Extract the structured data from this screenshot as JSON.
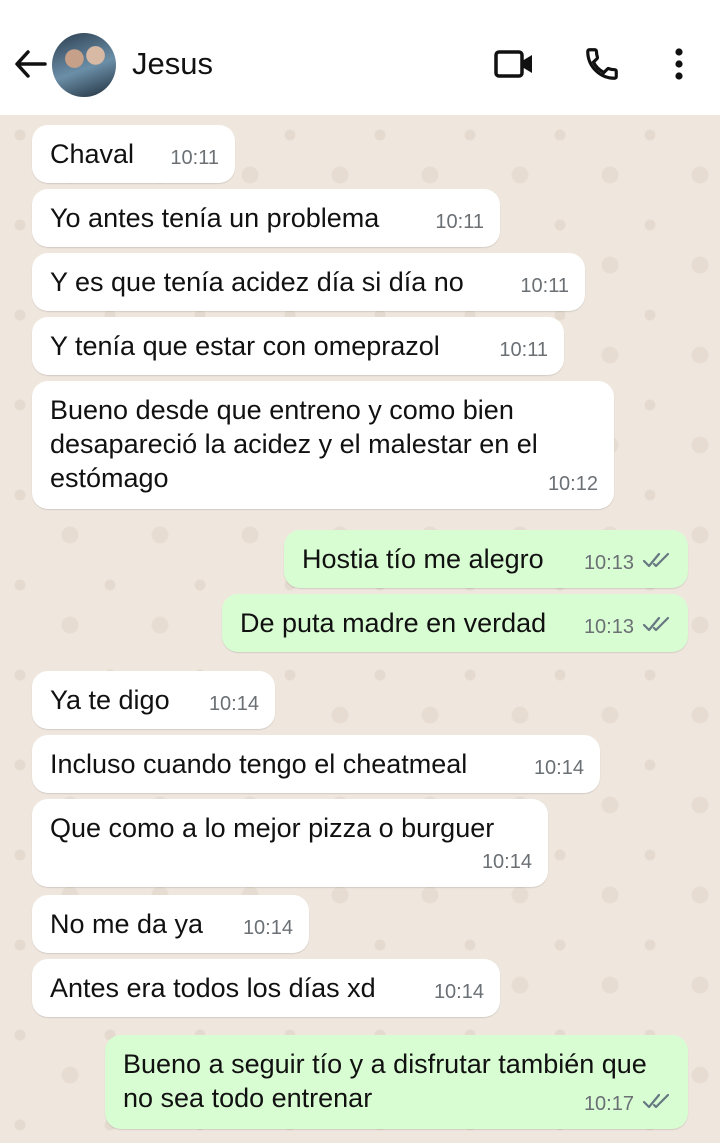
{
  "header": {
    "contact_name": "Jesus",
    "icons": [
      "back-arrow-icon",
      "video-call-icon",
      "phone-icon",
      "more-vertical-icon"
    ]
  },
  "colors": {
    "incoming_bubble": "#ffffff",
    "outgoing_bubble": "#d9fdd3",
    "chat_background": "#efe7de",
    "read_ticks": "#667781"
  },
  "messages": [
    {
      "dir": "in",
      "text": "Chaval",
      "time": "10:11"
    },
    {
      "dir": "in",
      "text": "Yo antes tenía un problema",
      "time": "10:11"
    },
    {
      "dir": "in",
      "text": "Y es que tenía acidez día si día no",
      "time": "10:11"
    },
    {
      "dir": "in",
      "text": "Y tenía que estar con omeprazol",
      "time": "10:11"
    },
    {
      "dir": "in",
      "text": "Bueno desde que entreno y como bien desapareció la acidez y el malestar en el estómago",
      "time": "10:12"
    },
    {
      "dir": "out",
      "text": "Hostia tío me alegro",
      "time": "10:13",
      "status": "read"
    },
    {
      "dir": "out",
      "text": "De puta madre en verdad",
      "time": "10:13",
      "status": "read"
    },
    {
      "dir": "in",
      "text": "Ya te digo",
      "time": "10:14"
    },
    {
      "dir": "in",
      "text": "Incluso cuando tengo el cheatmeal",
      "time": "10:14"
    },
    {
      "dir": "in",
      "text": "Que como a lo mejor pizza o burguer",
      "time": "10:14"
    },
    {
      "dir": "in",
      "text": "No me da ya",
      "time": "10:14"
    },
    {
      "dir": "in",
      "text": "Antes era todos los días xd",
      "time": "10:14"
    },
    {
      "dir": "out",
      "text": "Bueno a seguir tío y a disfrutar también que no sea todo entrenar",
      "time": "10:17",
      "status": "read"
    }
  ]
}
